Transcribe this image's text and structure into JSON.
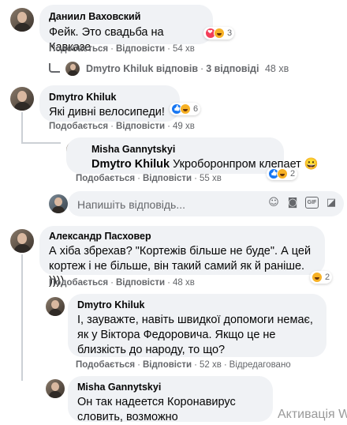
{
  "comments": [
    {
      "author": "Даниил Ваховский",
      "text": "Фейк. Это свадьба на Кавказе",
      "reaction_count": "3",
      "like": "Подобається",
      "reply": "Відповісти",
      "time": "54 хв",
      "replies_summary": {
        "author": "Dmytro Khiluk",
        "action": "відповів",
        "count": "3 відповіді",
        "time": "48 хв"
      }
    },
    {
      "author": "Dmytro Khiluk",
      "text": "Які дивні велосипеди!",
      "reaction_count": "6",
      "like": "Подобається",
      "reply": "Відповісти",
      "time": "49 хв",
      "reply_item": {
        "author": "Misha Gannytskyi",
        "mention": "Dmytro Khiluk",
        "text": "Укроборонпром клепает 😀",
        "reaction_count": "2",
        "like": "Подобається",
        "reply": "Відповісти",
        "time": "55 хв"
      },
      "reply_input": {
        "placeholder": "Напишіть відповідь..."
      }
    },
    {
      "author": "Александр Пасховер",
      "text": "А хіба збрехав? \"Кортежів більше не буде\". А цей кортеж і не більше, він такий самий як й раніше. ))))",
      "reaction_count": "2",
      "like": "Подобається",
      "reply": "Відповісти",
      "time": "48 хв",
      "reply_item": {
        "author": "Dmytro Khiluk",
        "text": "І, зауважте, навіть швидкої допомоги немає, як у Віктора Федоровича. Якщо це не близкість до народу, то що?",
        "like": "Подобається",
        "reply": "Відповісти",
        "time": "52 хв",
        "edited": "Відредаговано"
      },
      "reply_item_2": {
        "author": "Misha Gannytskyi",
        "text": "Он так надеется Коронавирус словить, возможно"
      }
    }
  ],
  "separator": "·",
  "watermark": "Активація W",
  "colors": {
    "bubble": "#f0f2f5",
    "meta": "#65676b",
    "heart": "#f33e58",
    "haha": "#f7b125",
    "like": "#1877f2"
  },
  "icons": [
    "heart-reaction-icon",
    "haha-reaction-icon",
    "like-reaction-icon",
    "reply-arrow-icon",
    "emoji-icon",
    "camera-icon",
    "gif-icon",
    "sticker-icon"
  ]
}
